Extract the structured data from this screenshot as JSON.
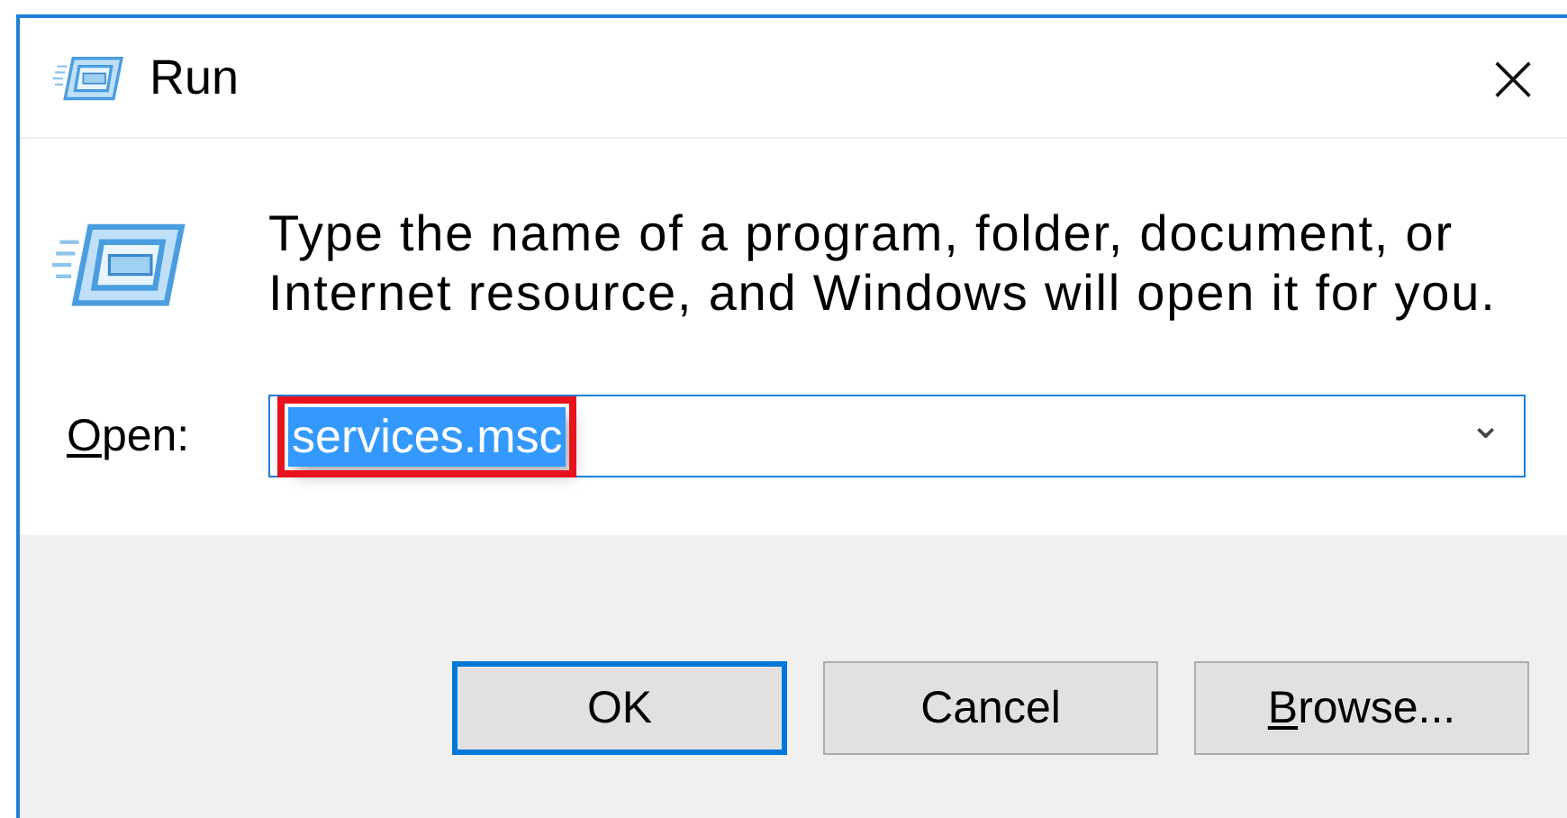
{
  "window": {
    "title": "Run",
    "close": "×"
  },
  "message": "Type the name of a program, folder, document, or Internet resource, and Windows will open it for you.",
  "open_field": {
    "label": "Open:",
    "value": "services.msc",
    "text_selected": true,
    "highlighted": true,
    "dropdown": "⌄"
  },
  "buttons": [
    {
      "label": "OK",
      "default": true
    },
    {
      "label": "Cancel",
      "default": false
    },
    {
      "label": "Browse...",
      "default": false
    }
  ]
}
